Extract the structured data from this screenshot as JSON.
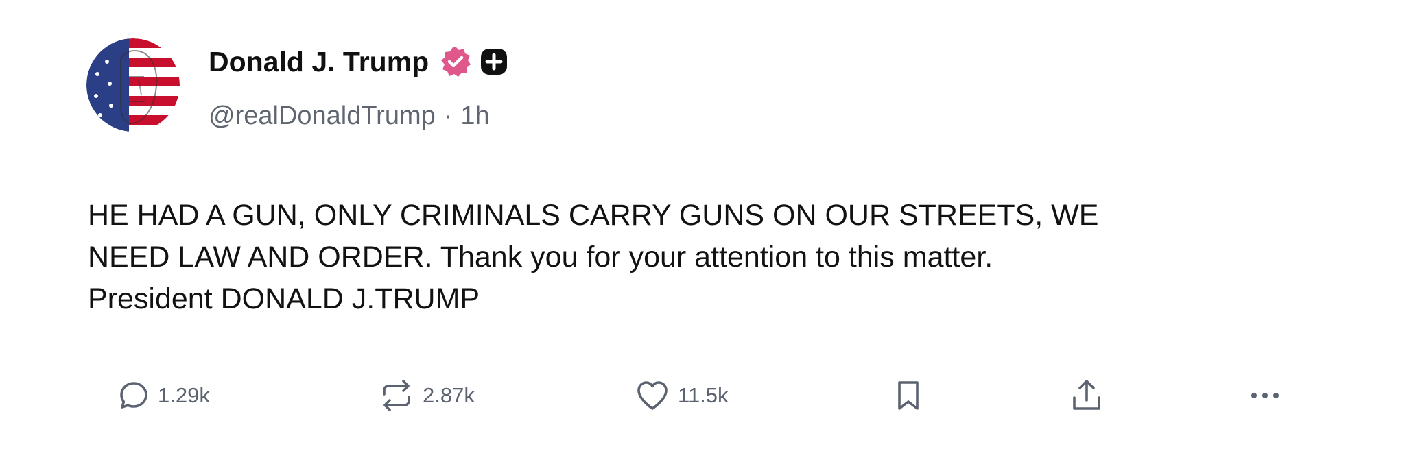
{
  "post": {
    "author": {
      "display_name": "Donald J. Trump",
      "handle": "@realDonaldTrump",
      "separator": "·",
      "time_ago": "1h",
      "avatar_icon": "flag-face-avatar",
      "verified_badge_icon": "verified-badge-icon",
      "verified_badge_color": "#e0578c",
      "plus_badge_icon": "plus-badge-icon"
    },
    "body_lines": [
      "HE HAD A GUN, ONLY CRIMINALS CARRY GUNS ON OUR STREETS, WE",
      "NEED LAW AND ORDER. Thank you for your attention to this matter.",
      "President DONALD J.TRUMP"
    ],
    "actions": {
      "reply": {
        "icon": "comment-icon",
        "count": "1.29k"
      },
      "repost": {
        "icon": "repost-icon",
        "count": "2.87k"
      },
      "like": {
        "icon": "heart-icon",
        "count": "11.5k"
      },
      "bookmark": {
        "icon": "bookmark-icon"
      },
      "share": {
        "icon": "share-icon"
      },
      "more": {
        "icon": "more-icon"
      }
    }
  },
  "colors": {
    "text": "#111111",
    "muted": "#5f6670",
    "badge_pink": "#e0578c"
  }
}
